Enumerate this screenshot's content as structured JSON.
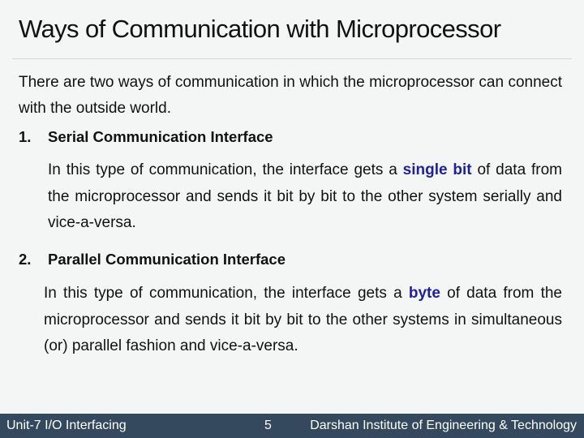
{
  "slide": {
    "title": "Ways of Communication with Microprocessor",
    "intro": "There are two ways of communication in which the microprocessor can connect with the outside world.",
    "sections": [
      {
        "number": "1.",
        "heading": "Serial Communication Interface",
        "text_before": "In this type of communication, the interface gets a ",
        "highlight": "single bit",
        "text_after": " of data from the microprocessor and sends it bit by bit to the other system serially and vice-a-versa."
      },
      {
        "number": "2.",
        "heading": "Parallel Communication Interface",
        "text_before": "In this type of communication, the interface gets a ",
        "highlight": "byte",
        "text_after": " of data from the microprocessor and sends it bit by bit to the other systems in simultaneous (or) parallel fashion and vice-a-versa."
      }
    ],
    "highlight_color": "#1f1fa0"
  },
  "footer": {
    "unit": "Unit-7 I/O Interfacing",
    "page": "5",
    "institute": "Darshan Institute of Engineering & Technology",
    "background": "#34495e"
  }
}
